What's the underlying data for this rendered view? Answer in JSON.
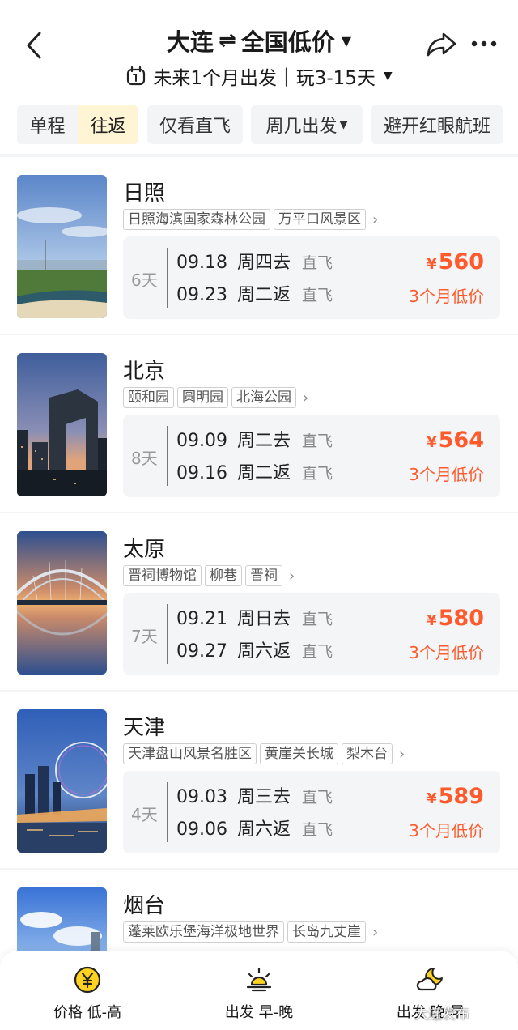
{
  "header": {
    "origin": "大连",
    "swap_symbol": "⇌",
    "destination": "全国低价",
    "date_range": "未来1个月出发",
    "separator": "|",
    "duration": "玩3-15天"
  },
  "filters": {
    "one_way": "单程",
    "round_trip": "往返",
    "round_trip_active": true,
    "nonstop_only": "仅看直飞",
    "weekday": "周几出发",
    "avoid_redeye": "避开红眼航班"
  },
  "results": [
    {
      "city": "日照",
      "tags": [
        "日照海滨国家森林公园",
        "万平口风景区"
      ],
      "days": "6天",
      "depart_date": "09.18",
      "depart_day": "周四去",
      "depart_type": "直飞",
      "return_date": "09.23",
      "return_day": "周二返",
      "return_type": "直飞",
      "currency": "¥",
      "price": "560",
      "price_note": "3个月低价"
    },
    {
      "city": "北京",
      "tags": [
        "颐和园",
        "圆明园",
        "北海公园"
      ],
      "days": "8天",
      "depart_date": "09.09",
      "depart_day": "周二去",
      "depart_type": "直飞",
      "return_date": "09.16",
      "return_day": "周二返",
      "return_type": "直飞",
      "currency": "¥",
      "price": "564",
      "price_note": "3个月低价"
    },
    {
      "city": "太原",
      "tags": [
        "晋祠博物馆",
        "柳巷",
        "晋祠"
      ],
      "days": "7天",
      "depart_date": "09.21",
      "depart_day": "周日去",
      "depart_type": "直飞",
      "return_date": "09.27",
      "return_day": "周六返",
      "return_type": "直飞",
      "currency": "¥",
      "price": "580",
      "price_note": "3个月低价"
    },
    {
      "city": "天津",
      "tags": [
        "天津盘山风景名胜区",
        "黄崖关长城",
        "梨木台"
      ],
      "days": "4天",
      "depart_date": "09.03",
      "depart_day": "周三去",
      "depart_type": "直飞",
      "return_date": "09.06",
      "return_day": "周六返",
      "return_type": "直飞",
      "currency": "¥",
      "price": "589",
      "price_note": "3个月低价"
    },
    {
      "city": "烟台",
      "tags": [
        "蓬莱欧乐堡海洋极地世界",
        "长岛九丈崖"
      ]
    }
  ],
  "sort_bar": {
    "price": "价格 低-高",
    "depart": "出发 早-晚",
    "arrive": "出发 晚-早"
  },
  "watermark": "大连发布",
  "colors": {
    "accent": "#ff5a2c",
    "active_chip": "#fff4d4",
    "icon_yellow": "#ffd21f"
  },
  "icons": {
    "back": "chevron-left-icon",
    "share": "share-arrow-icon",
    "more": "more-dots-icon",
    "calendar": "calendar-icon",
    "price_sort": "yen-coin-icon",
    "depart_sort": "sunrise-icon",
    "arrive_sort": "moon-cloud-icon"
  }
}
